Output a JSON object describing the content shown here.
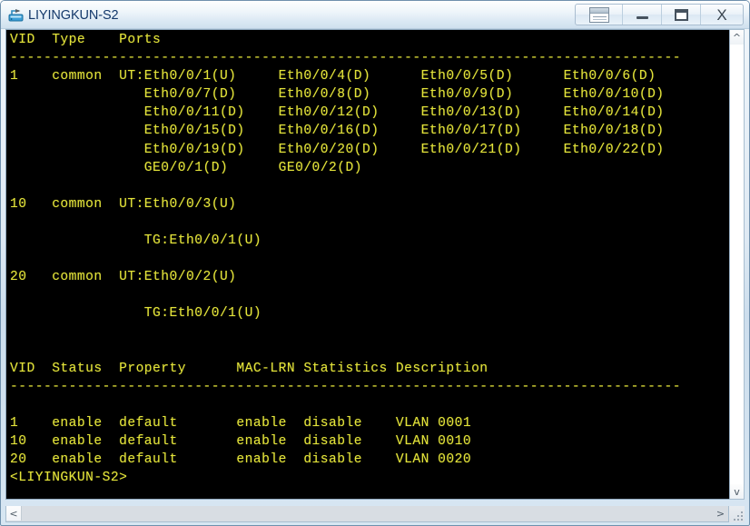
{
  "window": {
    "title": "LIYINGKUN-S2",
    "app_icon": "switch-icon",
    "title_color": "#14396b"
  },
  "titlebar_buttons": [
    {
      "name": "window-restore-size-button",
      "icon": "window-icon",
      "label": ""
    },
    {
      "name": "minimize-button",
      "icon": "minimize-icon",
      "label": ""
    },
    {
      "name": "maximize-button",
      "icon": "maximize-icon",
      "label": ""
    },
    {
      "name": "close-button",
      "icon": "close-icon",
      "label": "X"
    }
  ],
  "terminal": {
    "background": "#000000",
    "foreground": "#e3e33a",
    "prompt": "<LIYINGKUN-S2>",
    "content": "VID  Type    Ports\n--------------------------------------------------------------------------------\n1    common  UT:Eth0/0/1(U)     Eth0/0/4(D)      Eth0/0/5(D)      Eth0/0/6(D)\n                Eth0/0/7(D)     Eth0/0/8(D)      Eth0/0/9(D)      Eth0/0/10(D)\n                Eth0/0/11(D)    Eth0/0/12(D)     Eth0/0/13(D)     Eth0/0/14(D)\n                Eth0/0/15(D)    Eth0/0/16(D)     Eth0/0/17(D)     Eth0/0/18(D)\n                Eth0/0/19(D)    Eth0/0/20(D)     Eth0/0/21(D)     Eth0/0/22(D)\n                GE0/0/1(D)      GE0/0/2(D)\n\n10   common  UT:Eth0/0/3(U)\n\n                TG:Eth0/0/1(U)\n\n20   common  UT:Eth0/0/2(U)\n\n                TG:Eth0/0/1(U)\n\n\nVID  Status  Property      MAC-LRN Statistics Description\n--------------------------------------------------------------------------------\n\n1    enable  default       enable  disable    VLAN 0001\n10   enable  default       enable  disable    VLAN 0010\n20   enable  default       enable  disable    VLAN 0020\n<LIYINGKUN-S2>"
  },
  "vlan_port_table": {
    "headers": [
      "VID",
      "Type",
      "Ports"
    ],
    "rows": [
      {
        "vid": "1",
        "type": "common",
        "ports": [
          [
            "UT:Eth0/0/1(U)",
            "Eth0/0/4(D)",
            "Eth0/0/5(D)",
            "Eth0/0/6(D)"
          ],
          [
            "Eth0/0/7(D)",
            "Eth0/0/8(D)",
            "Eth0/0/9(D)",
            "Eth0/0/10(D)"
          ],
          [
            "Eth0/0/11(D)",
            "Eth0/0/12(D)",
            "Eth0/0/13(D)",
            "Eth0/0/14(D)"
          ],
          [
            "Eth0/0/15(D)",
            "Eth0/0/16(D)",
            "Eth0/0/17(D)",
            "Eth0/0/18(D)"
          ],
          [
            "Eth0/0/19(D)",
            "Eth0/0/20(D)",
            "Eth0/0/21(D)",
            "Eth0/0/22(D)"
          ],
          [
            "GE0/0/1(D)",
            "GE0/0/2(D)"
          ]
        ]
      },
      {
        "vid": "10",
        "type": "common",
        "ports": [
          [
            "UT:Eth0/0/3(U)"
          ],
          [
            "TG:Eth0/0/1(U)"
          ]
        ]
      },
      {
        "vid": "20",
        "type": "common",
        "ports": [
          [
            "UT:Eth0/0/2(U)"
          ],
          [
            "TG:Eth0/0/1(U)"
          ]
        ]
      }
    ]
  },
  "vlan_status_table": {
    "headers": [
      "VID",
      "Status",
      "Property",
      "MAC-LRN",
      "Statistics",
      "Description"
    ],
    "rows": [
      [
        "1",
        "enable",
        "default",
        "enable",
        "disable",
        "VLAN 0001"
      ],
      [
        "10",
        "enable",
        "default",
        "enable",
        "disable",
        "VLAN 0010"
      ],
      [
        "20",
        "enable",
        "default",
        "enable",
        "disable",
        "VLAN 0020"
      ]
    ]
  },
  "scrollbars": {
    "vertical": {
      "up_arrow": "^",
      "down_arrow": "v"
    },
    "horizontal": {
      "left_arrow": "<",
      "right_arrow": ">"
    }
  }
}
